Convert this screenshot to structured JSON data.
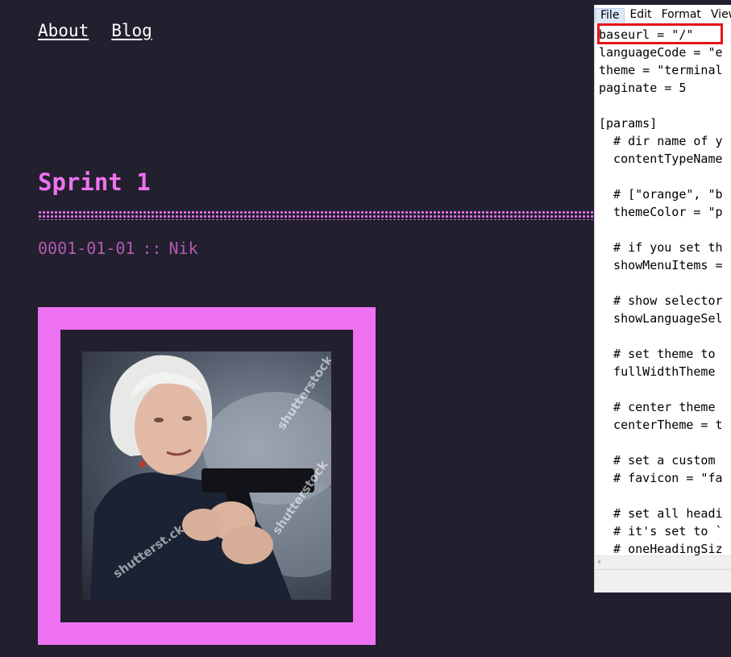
{
  "nav": {
    "about": "About",
    "blog": "Blog"
  },
  "post": {
    "title": "Sprint 1",
    "date": "0001-01-01",
    "separator": "::",
    "author": "Nik"
  },
  "image": {
    "watermark_1": "shutterstock",
    "watermark_2": "shutterstock",
    "watermark_3": "shutterst.ck"
  },
  "notepad": {
    "menu": [
      "File",
      "Edit",
      "Format",
      "View"
    ],
    "lines": [
      "baseurl = \"/\"",
      "languageCode = \"e",
      "theme = \"terminal",
      "paginate = 5",
      "",
      "[params]",
      "  # dir name of y",
      "  contentTypeName",
      "",
      "  # [\"orange\", \"b",
      "  themeColor = \"p",
      "",
      "  # if you set th",
      "  showMenuItems =",
      "",
      "  # show selector",
      "  showLanguageSel",
      "",
      "  # set theme to",
      "  fullWidthTheme",
      "",
      "  # center theme",
      "  centerTheme = t",
      "",
      "  # set a custom",
      "  # favicon = \"fa",
      "",
      "  # set all headi",
      "  # it's set to `",
      "  # oneHeadingSiz"
    ]
  },
  "colors": {
    "background": "#221f2e",
    "accent": "#ee72f1",
    "meta": "#b15bb3",
    "highlight_box": "#e8131a"
  }
}
